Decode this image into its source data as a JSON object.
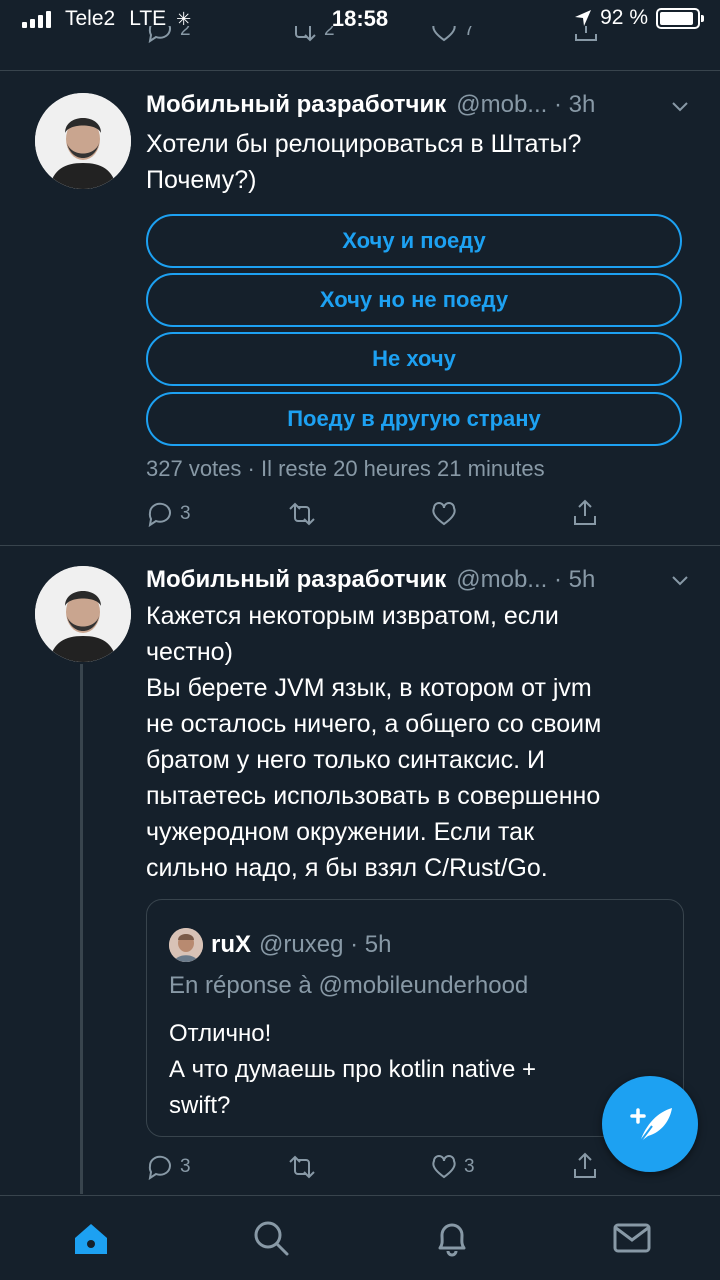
{
  "status": {
    "carrier": "Tele2",
    "network": "LTE",
    "time": "18:58",
    "battery": "92 %",
    "battery_level": 0.92
  },
  "prev_actions": {
    "reply_count": "2",
    "retweet_count": "2",
    "like_count": "7"
  },
  "tweet1": {
    "name": "Мобильный разработчик",
    "handle_time": "@mob... · 3h",
    "text": "Хотели бы релоцироваться в Штаты?\nПочему?)",
    "poll": {
      "options": [
        "Хочу и поеду",
        "Хочу но не поеду",
        "Не хочу",
        "Поеду в другую страну"
      ],
      "meta": "327 votes · Il reste 20 heures 21 minutes"
    },
    "reply_count": "3"
  },
  "tweet2": {
    "name": "Мобильный разработчик",
    "handle_time": "@mob... · 5h",
    "text": "Кажется некоторым извратом, если\nчестно)\nВы берете JVM язык, в котором от jvm\nне осталось ничего, а общего со своим\nбратом у него только синтаксис. И\nпытаетесь использовать в совершенно\nчужеродном окружении. Если так\nсильно надо, я бы взял C/Rust/Go.",
    "quote": {
      "name": "ruX",
      "handle_time": "@ruxeg · 5h",
      "reply_to": "En réponse à @mobileunderhood",
      "text": "Отлично!\nА что думаешь про kotlin native +\nswift?"
    },
    "reply_count": "3",
    "like_count": "3"
  },
  "colors": {
    "background": "#15202b",
    "accent": "#1da1f2",
    "secondary_text": "#8899a6",
    "divider": "#38444d"
  },
  "icons": {
    "reply": "reply-icon",
    "retweet": "retweet-icon",
    "like": "heart-icon",
    "share": "share-icon",
    "compose": "compose-tweet-icon",
    "home": "home-icon",
    "search": "search-icon",
    "notifications": "bell-icon",
    "messages": "mail-icon"
  }
}
